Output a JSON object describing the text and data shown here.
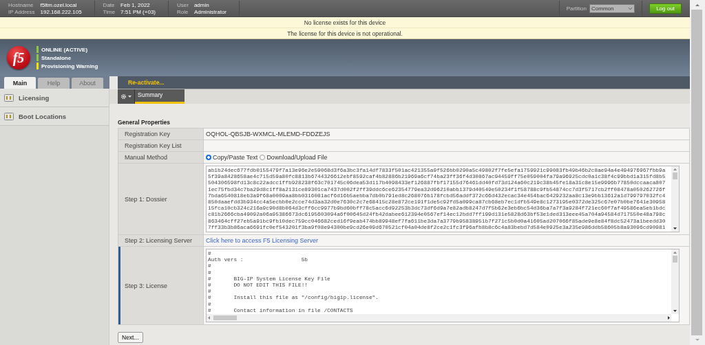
{
  "top_bar": {
    "groups": [
      [
        {
          "label": "Hostname",
          "value": "f5ltm.ozel.local"
        },
        {
          "label": "IP Address",
          "value": "192.168.222.105"
        }
      ],
      [
        {
          "label": "Date",
          "value": "Feb 1, 2022"
        },
        {
          "label": "Time",
          "value": "7:51 PM (+03)"
        }
      ],
      [
        {
          "label": "User",
          "value": "admin"
        },
        {
          "label": "Role",
          "value": "Administrator"
        }
      ]
    ],
    "partition": {
      "label": "Partition",
      "value": "Common"
    },
    "logout": "Log out"
  },
  "alerts": [
    "No license exists for this device",
    "The license for this device is not operational."
  ],
  "header": {
    "logo_text": "f5",
    "status": [
      {
        "text": "ONLINE (ACTIVE)",
        "color": "#8dc63f"
      },
      {
        "text": "Standalone",
        "color": "#8dc63f"
      },
      {
        "text": "Provisioning Warning",
        "color": "#f2e600"
      }
    ]
  },
  "tabs": [
    {
      "label": "Main",
      "selected": true
    },
    {
      "label": "Help",
      "selected": false
    },
    {
      "label": "About",
      "selected": false
    }
  ],
  "sidebar": {
    "items": [
      "Licensing",
      "Boot Locations"
    ]
  },
  "action_bar": {
    "link": "Re-activate..."
  },
  "subtabs": [
    {
      "label": "Summary",
      "selected": true
    }
  ],
  "section_title": "General Properties",
  "properties": [
    {
      "kind": "text",
      "label": "Registration Key",
      "value": "OQHOL-QBSJB-WXMCL-MLEMD-FDDZEJS",
      "focused": false
    },
    {
      "kind": "text",
      "label": "Registration Key List",
      "focused": false
    },
    {
      "kind": "radio",
      "label": "Manual Method",
      "focused": false,
      "options": [
        {
          "label": "Copy/Paste Text",
          "selected": true
        },
        {
          "label": "Download/Upload File",
          "selected": false
        }
      ]
    },
    {
      "kind": "textarea",
      "label": "Step 1: Dossier",
      "focused": false,
      "value": "ab1b24dec677fdb0155479f7a13e96e2e59068d3f6a3bc3fa14df7833f501ac421355a9f526bb0290a5c49802f7fe5efa1759921c99083fb49b46b2c8ae94a4e494976967fbb9a\n5f39a8428658ae4c715d59a80fc8813b6744326612ebf8592caf4b82886b21969a6cf74ba23ff36f4d30867ac94459ff75e059004fa79a96925cdc0a1c38f4c99bbd1a315fd8b5\n504306598fd13c8c22adcc1ffb928238f63c701745c06dea53d117b4098433ef126887fbf17155d76461dd40fd73d124a60c219c38b45fe18a31c8e15e9996b77850dccaaca807\n1ec75fbd34c7ba29d8c1ff8a2131ce89301ca7437d002f2ff39ddc6ce62354779ea32d96210abb1379d40549e50234f1f58788c9fb54874cc7d3f5717cb2ff08478a050262726f\n7bda6540818eb3a9f68a0009aa8bb0316081acf6d16b5aebba7db0b791ed8c268076b178fcbd56addf372c66d432ecac34e454bac6429232aa8c13e9bb13612a1d799797032fc4\n850daaefdd3b934cc4a5ecbb0e2cce74d3aa32d0e7630c2c7e68415c28e872ce191f1de5c92fd5a099ca87cb68eb7ec1dfb549e8c1273195e0372de325c67e07b0be7641e30958\n15fca10cb324c216a9c90d8b064d3cff6cc9977b9bd60bff78c5acc6d92253b3dc73df6d9a7e82adb8247d7f5b62e3eb6bc54d36ba7a7f3a9284f721ec60f7af49586ea5eb1bdc\nc81b2666cba49092a06a95386673dc6195603094a6f00645d24fb42dabee612394e0567ef14ec12bdd7ff199d131e5828d63bf53e1ded313eee45a704a94584d717550e48a798c\n863464cff27eb5a91bc9fb10dec759cc046682ced16f9eab474bb89948ef7fa611be3da7a3779b95838951b7f271c5b0d0a41605ad207066f85ade9e8e84f8dc52473a1beedd30\n7ff33b3b86aca6691fc0ef543201f3ba9f08e94300be9cd26e09d670521cf04a04de8f2ce2c1fc3f96afb8b8c6c4a83bebd7d584e0925e3a235e986ddb58605b8a93096cd90981"
    },
    {
      "kind": "link",
      "label": "Step 2: Licensing Server",
      "value": "Click here to access F5 Licensing Server",
      "focused": false
    },
    {
      "kind": "textarea",
      "label": "Step 3: License",
      "focused": true,
      "value": "#\nAuth vers :                  5b\n#\n#\n#       BIG-IP System License Key File\n#       DO NOT EDIT THIS FILE!!\n#\n#       Install this file as \"/config/bigip.license\".\n#\n#       Contact information in file /CONTACTS"
    }
  ],
  "buttons": [
    "Next..."
  ]
}
